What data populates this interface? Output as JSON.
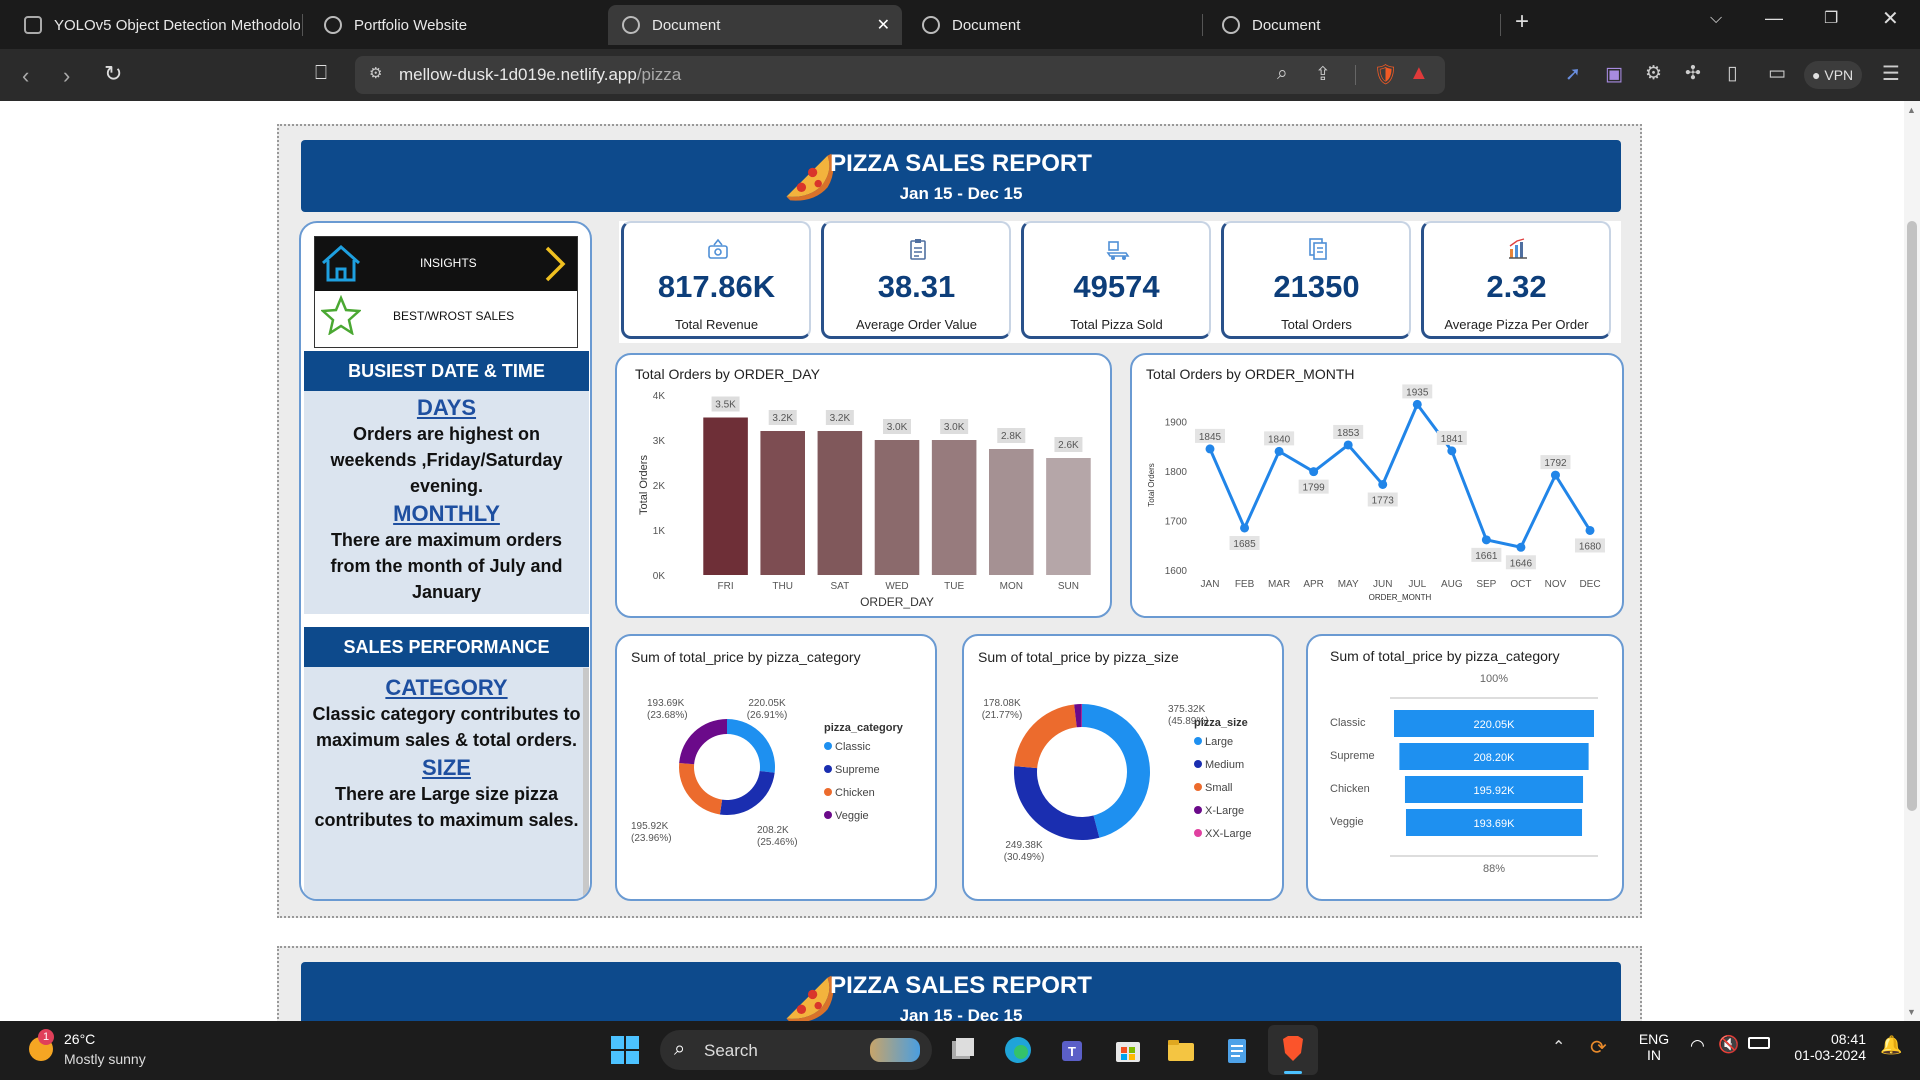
{
  "browser": {
    "tabs": [
      {
        "title": "YOLOv5 Object Detection Methodolo",
        "active": false
      },
      {
        "title": "Portfolio Website",
        "active": false
      },
      {
        "title": "Document",
        "active": true
      },
      {
        "title": "Document",
        "active": false
      },
      {
        "title": "Document",
        "active": false
      }
    ],
    "url_host": "mellow-dusk-1d019e.netlify.app",
    "url_path": "/pizza",
    "vpn_label": "VPN"
  },
  "report": {
    "title": "PIZZA SALES REPORT",
    "subtitle": "Jan 15 - Dec 15",
    "nav": {
      "insights": "INSIGHTS",
      "best": "BEST/WROST SALES"
    },
    "busiest": {
      "header": "BUSIEST DATE & TIME",
      "days_title": "DAYS",
      "days_text": "Orders are highest on weekends ,Friday/Saturday evening.",
      "monthly_title": "MONTHLY",
      "monthly_text": "There are maximum orders from the month of July and January"
    },
    "sales": {
      "header": "SALES PERFORMANCE",
      "category_title": "CATEGORY",
      "category_text": "Classic category contributes to maximum sales & total orders.",
      "size_title": "SIZE",
      "size_text": "There are Large size pizza contributes to maximum sales."
    },
    "kpis": [
      {
        "value": "817.86K",
        "label": "Total Revenue"
      },
      {
        "value": "38.31",
        "label": "Average Order Value"
      },
      {
        "value": "49574",
        "label": "Total Pizza Sold"
      },
      {
        "value": "21350",
        "label": "Total Orders"
      },
      {
        "value": "2.32",
        "label": "Average Pizza Per Order"
      }
    ]
  },
  "chart_data": [
    {
      "type": "bar",
      "title": "Total Orders by ORDER_DAY",
      "xlabel": "ORDER_DAY",
      "ylabel": "Total Orders",
      "categories": [
        "FRI",
        "THU",
        "SAT",
        "WED",
        "TUE",
        "MON",
        "SUN"
      ],
      "values": [
        3500,
        3200,
        3200,
        3000,
        3000,
        2800,
        2600
      ],
      "data_labels": [
        "3.5K",
        "3.2K",
        "3.2K",
        "3.0K",
        "3.0K",
        "2.8K",
        "2.6K"
      ],
      "yticks": [
        "0K",
        "1K",
        "2K",
        "3K",
        "4K"
      ],
      "ylim": [
        0,
        4000
      ],
      "colors": [
        "#6e2f37",
        "#7d4d52",
        "#80585b",
        "#8b6a6c",
        "#977b7d",
        "#a59193",
        "#b5a6a8"
      ]
    },
    {
      "type": "line",
      "title": "Total Orders by ORDER_MONTH",
      "xlabel": "ORDER_MONTH",
      "ylabel": "Total Orders",
      "categories": [
        "JAN",
        "FEB",
        "MAR",
        "APR",
        "MAY",
        "JUN",
        "JUL",
        "AUG",
        "SEP",
        "OCT",
        "NOV",
        "DEC"
      ],
      "values": [
        1845,
        1685,
        1840,
        1799,
        1853,
        1773,
        1935,
        1841,
        1661,
        1646,
        1792,
        1680
      ],
      "yticks": [
        "1600",
        "1700",
        "1800",
        "1900"
      ],
      "ylim": [
        1600,
        1950
      ],
      "color": "#2185e8"
    },
    {
      "type": "pie",
      "title": "Sum of total_price by pizza_category",
      "legend_title": "pizza_category",
      "labels": [
        "Classic",
        "Supreme",
        "Chicken",
        "Veggie"
      ],
      "values": [
        220.05,
        208.2,
        195.92,
        193.69
      ],
      "data_labels": [
        "220.05K\n(26.91%)",
        "208.2K\n(25.46%)",
        "195.92K\n(23.96%)",
        "193.69K\n(23.68%)"
      ],
      "colors": [
        "#1e90f0",
        "#1a2eb0",
        "#ec6b2d",
        "#6b0a8a"
      ]
    },
    {
      "type": "pie",
      "title": "Sum of total_price by pizza_size",
      "legend_title": "pizza_size",
      "labels": [
        "Large",
        "Medium",
        "Small",
        "X-Large",
        "XX-Large"
      ],
      "values": [
        375.32,
        249.38,
        178.08,
        14.08,
        1.01
      ],
      "data_labels": [
        "375.32K\n(45.89%)",
        "249.38K\n(30.49%)",
        "178.08K\n(21.77%)",
        "",
        ""
      ],
      "colors": [
        "#1e90f0",
        "#1a2eb0",
        "#ec6b2d",
        "#6b0a8a",
        "#e040a0"
      ]
    },
    {
      "type": "bar",
      "title": "Sum of total_price by pizza_category",
      "orientation": "horizontal",
      "categories": [
        "Classic",
        "Supreme",
        "Chicken",
        "Veggie"
      ],
      "values": [
        220.05,
        208.2,
        195.92,
        193.69
      ],
      "data_labels": [
        "220.05K",
        "208.20K",
        "195.92K",
        "193.69K"
      ],
      "top_label": "100%",
      "bottom_label": "88%",
      "color": "#1e90f0"
    }
  ],
  "taskbar": {
    "weather_temp": "26°C",
    "weather_desc": "Mostly sunny",
    "weather_badge": "1",
    "search": "Search",
    "lang1": "ENG",
    "lang2": "IN",
    "time": "08:41",
    "date": "01-03-2024"
  }
}
